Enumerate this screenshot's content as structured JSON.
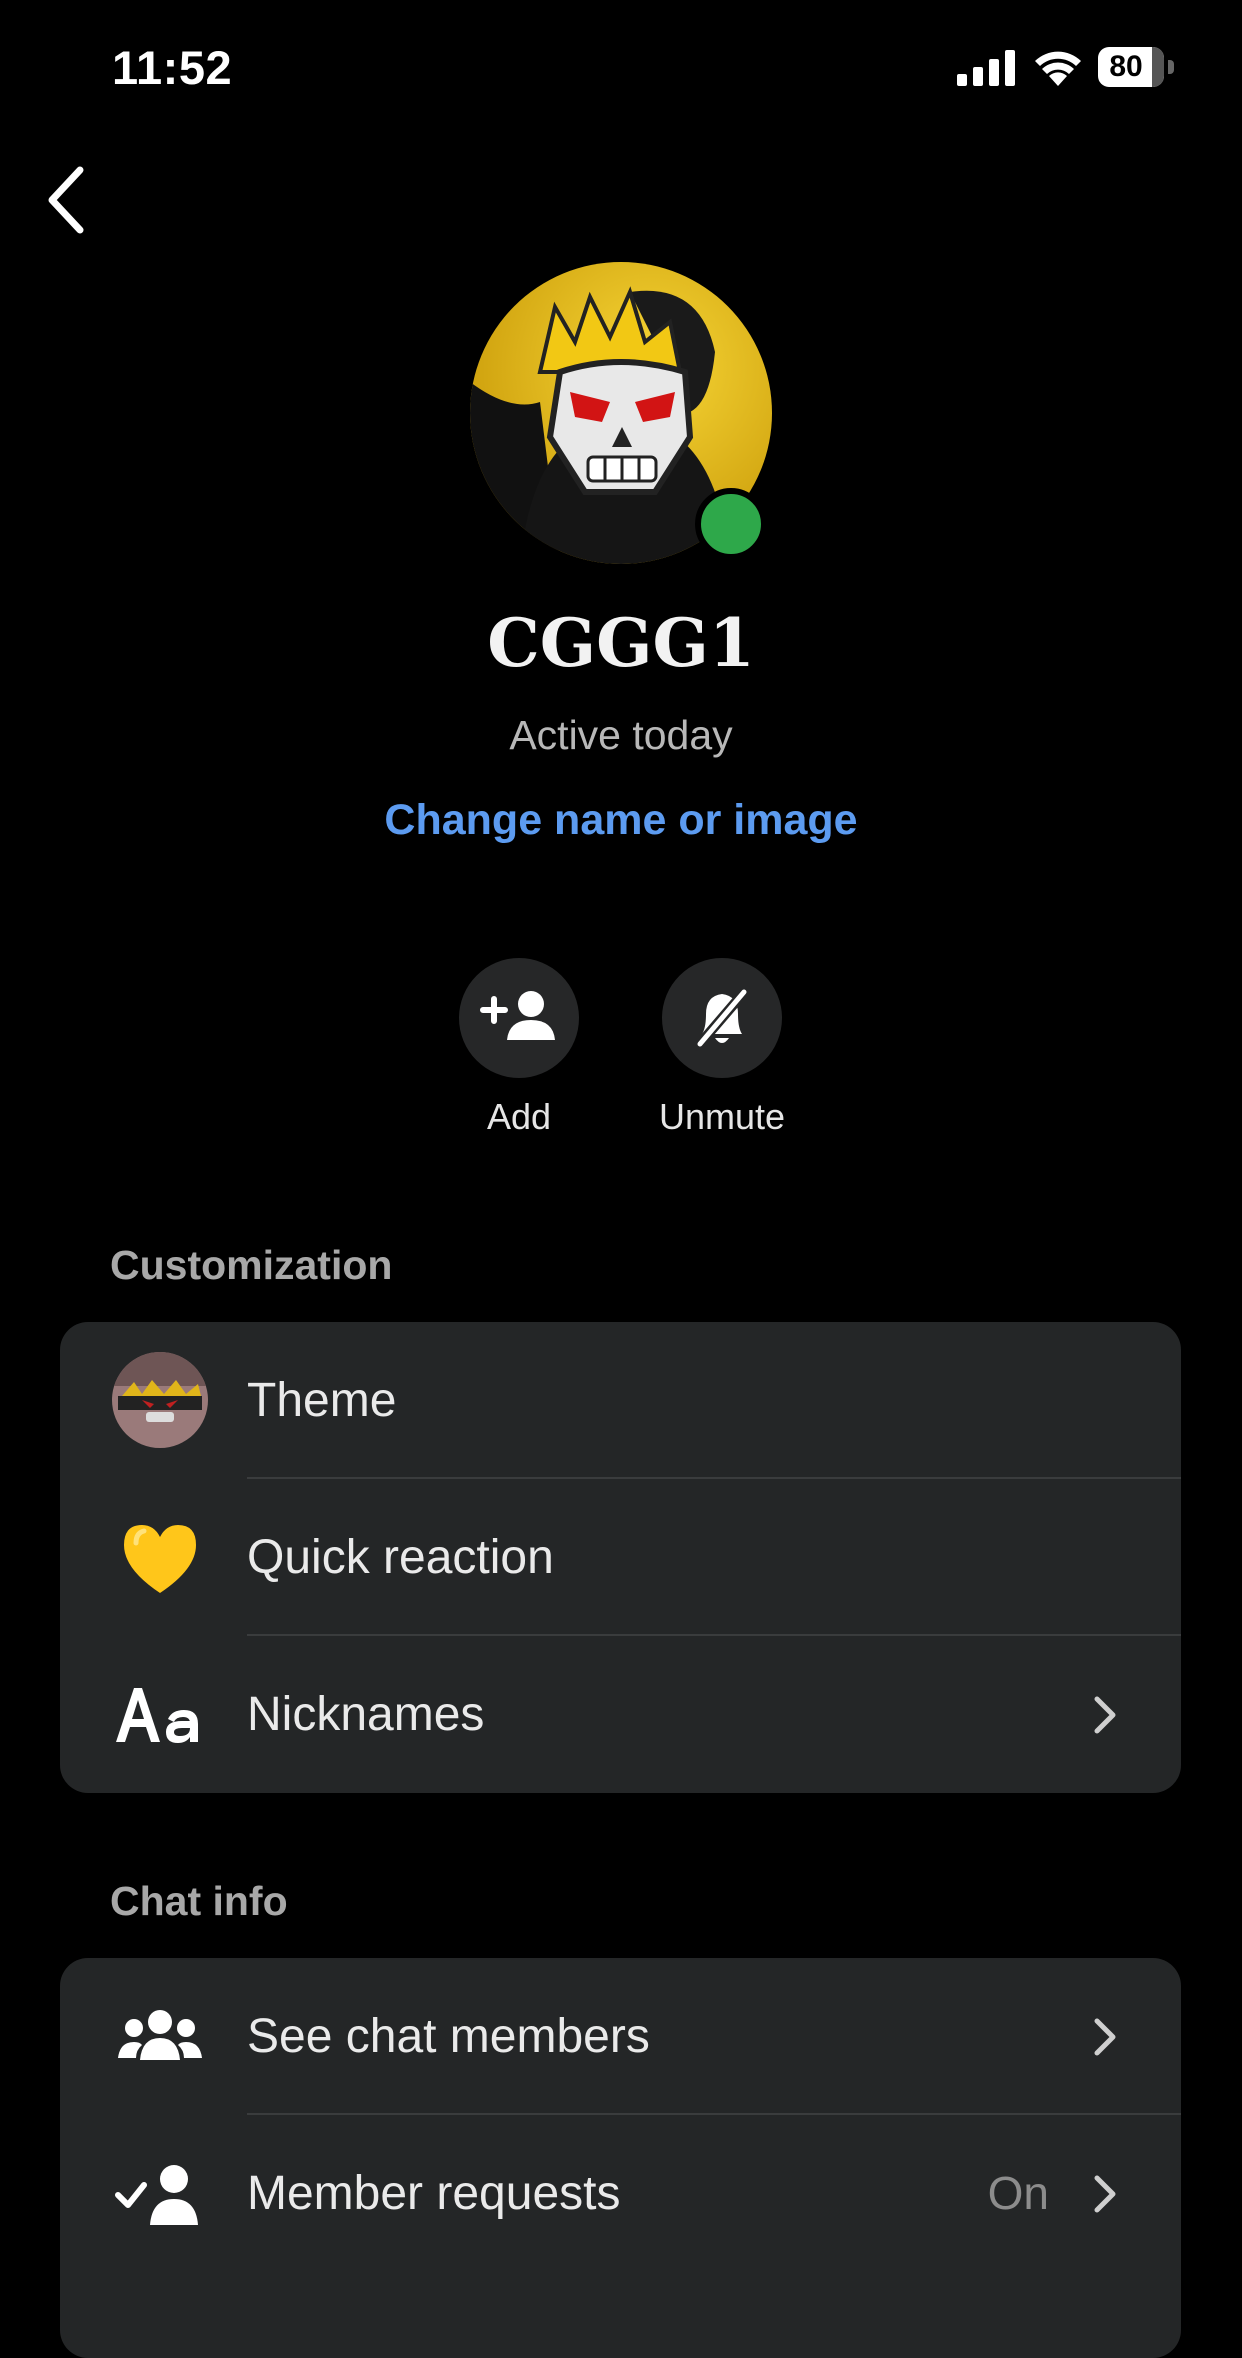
{
  "status_bar": {
    "time": "11:52",
    "battery": "80",
    "icons": [
      "cellular-signal-icon",
      "wifi-icon",
      "battery-icon"
    ]
  },
  "header": {
    "back_icon": "chevron-left-icon"
  },
  "profile": {
    "name": "CGGG1",
    "status": "Active today",
    "change_link": "Change name or image",
    "online_color": "#2ea84a",
    "link_color": "#5c9bf0"
  },
  "actions": [
    {
      "label": "Add",
      "icon": "add-person-icon"
    },
    {
      "label": "Unmute",
      "icon": "bell-muted-icon"
    }
  ],
  "customization": {
    "title": "Customization",
    "items": [
      {
        "label": "Theme",
        "icon": "theme-thumbnail"
      },
      {
        "label": "Quick reaction",
        "icon": "yellow-heart-icon"
      },
      {
        "label": "Nicknames",
        "icon": "text-aa-icon"
      }
    ]
  },
  "chat_info": {
    "title": "Chat info",
    "items": [
      {
        "label": "See chat members",
        "icon": "people-group-icon"
      },
      {
        "label": "Member requests",
        "value": "On",
        "icon": "person-check-icon"
      }
    ]
  }
}
